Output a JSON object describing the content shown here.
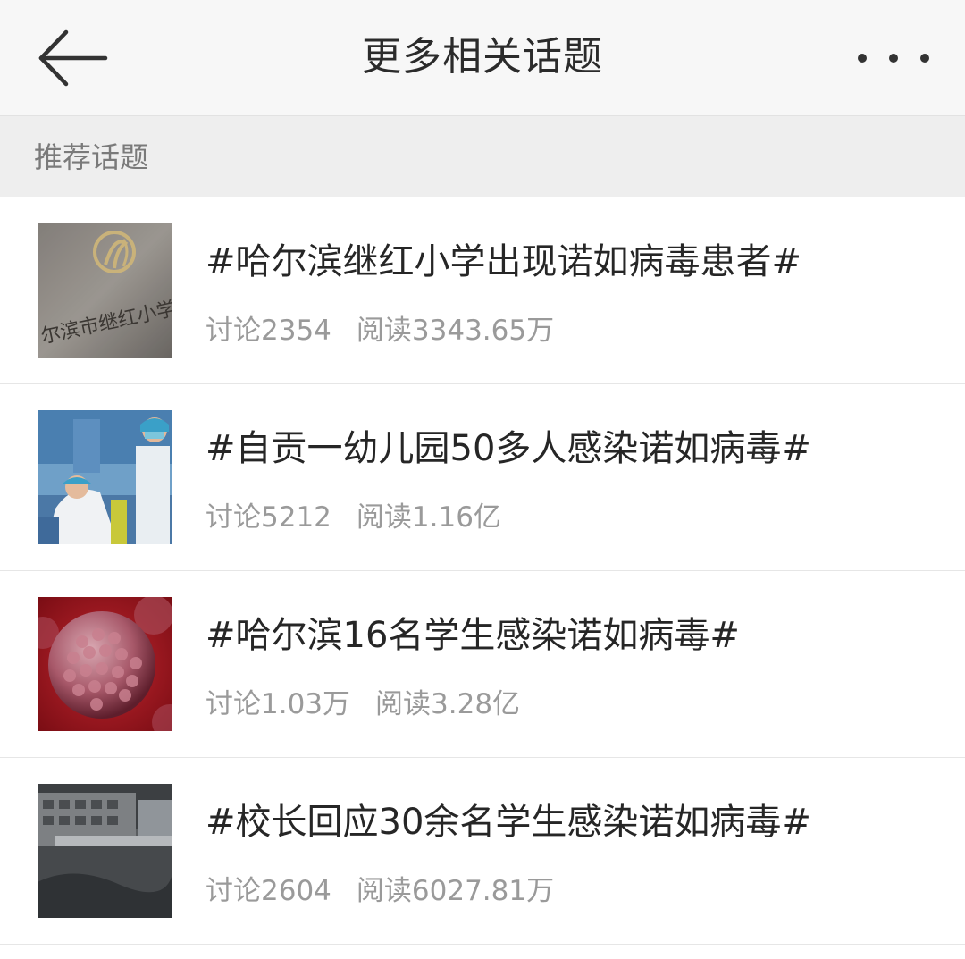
{
  "header": {
    "title": "更多相关话题",
    "back_icon": "arrow-left-icon",
    "more_icon": "more-dots-icon"
  },
  "section": {
    "label": "推荐话题"
  },
  "topics": [
    {
      "title": "#哈尔滨继红小学出现诺如病毒患者#",
      "discussion": "讨论2354",
      "reads": "阅读3343.65万",
      "thumbnail_logo_text": "尔滨市继红小学"
    },
    {
      "title": "#自贡一幼儿园50多人感染诺如病毒#",
      "discussion": "讨论5212",
      "reads": "阅读1.16亿"
    },
    {
      "title": "#哈尔滨16名学生感染诺如病毒#",
      "discussion": "讨论1.03万",
      "reads": "阅读3.28亿"
    },
    {
      "title": "#校长回应30余名学生感染诺如病毒#",
      "discussion": "讨论2604",
      "reads": "阅读6027.81万"
    }
  ],
  "colors": {
    "header_bg": "#f7f7f7",
    "section_bg": "#eeeeee",
    "title_text": "#262626",
    "meta_text": "#9a9a9a",
    "virus_red": "#b0202a"
  }
}
